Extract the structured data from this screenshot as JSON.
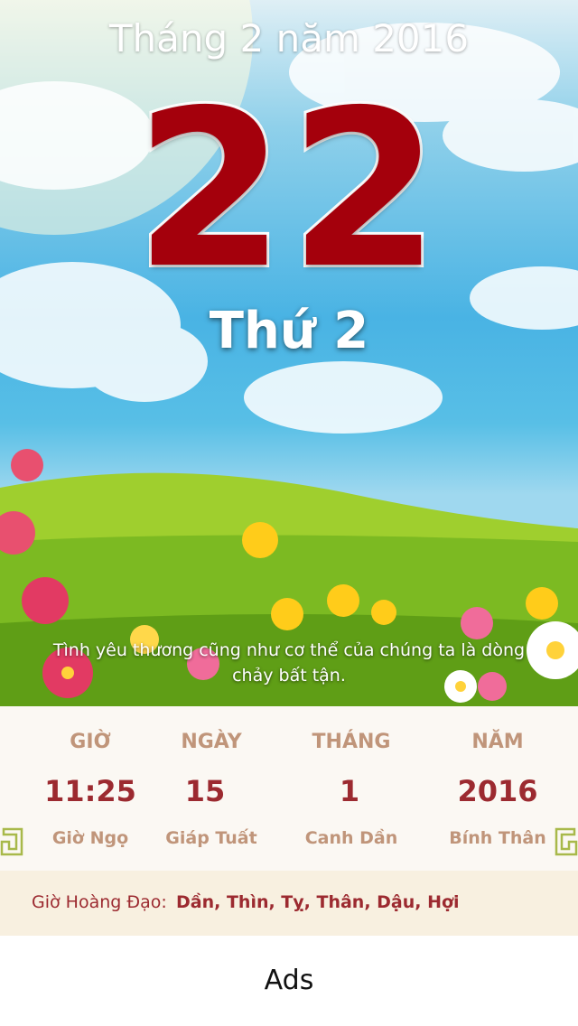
{
  "header": {
    "month_title": "Tháng 2 năm 2016",
    "day_number": "22",
    "weekday": "Thứ 2"
  },
  "quote": {
    "line1": "Tình yêu thương cũng như cơ thể của chúng ta là dòng",
    "line2": "chảy bất tận."
  },
  "lunar": {
    "columns": [
      {
        "label": "GIỜ",
        "value": "11:25",
        "sub": "Giờ Ngọ"
      },
      {
        "label": "NGÀY",
        "value": "15",
        "sub": "Giáp Tuất"
      },
      {
        "label": "THÁNG",
        "value": "1",
        "sub": "Canh Dần"
      },
      {
        "label": "NĂM",
        "value": "2016",
        "sub": "Bính Thân"
      }
    ]
  },
  "hoang_dao": {
    "label": "Giờ Hoàng Đạo:",
    "hours": "Dần, Thìn, Tỵ, Thân, Dậu, Hợi"
  },
  "ads": {
    "label": "Ads"
  },
  "colors": {
    "day_red": "#a4000c",
    "lunar_label": "#c0957a",
    "lunar_value": "#9c2a30",
    "corner_ornament": "#a8b94a"
  }
}
